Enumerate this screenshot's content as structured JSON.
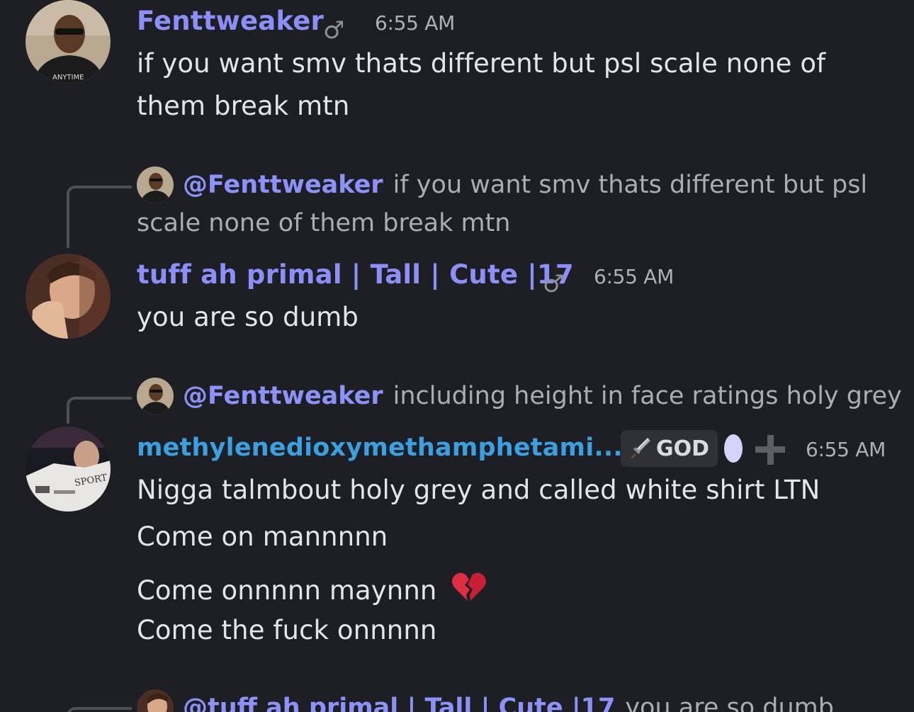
{
  "messages": [
    {
      "username": "Fenttweaker",
      "username_color": "#8c8ff7",
      "gender_icon": "♂",
      "time": "6:55 AM",
      "lines": [
        "if you want smv thats different but psl scale none of",
        "them break mtn"
      ]
    },
    {
      "reply": {
        "mention": "@Fenttweaker",
        "text_line1": "if you want smv thats different but psl",
        "text_line2": "scale none of them break mtn"
      },
      "username": "tuff ah primal | Tall | Cute |17",
      "username_color": "#8c8ff7",
      "gender_icon": "♂",
      "time": "6:55 AM",
      "lines": [
        "you are so dumb"
      ]
    },
    {
      "reply": {
        "mention": "@Fenttweaker",
        "text_line1": "including height in face ratings holy grey"
      },
      "username": "methylenedioxymethamphetami...",
      "username_color": "#3aa0e0",
      "badge": {
        "icon": "sword-icon",
        "label": "GOD"
      },
      "time": "6:55 AM",
      "lines": [
        "Nigga talmbout holy grey and called white shirt LTN",
        "Come on mannnnn",
        "Come onnnnn maynnn",
        "Come the fuck onnnnn"
      ],
      "emoji": "💔"
    }
  ],
  "next_reply": {
    "mention": "@tuff ah primal | Tall | Cute |17",
    "text": "you are so dumb"
  }
}
